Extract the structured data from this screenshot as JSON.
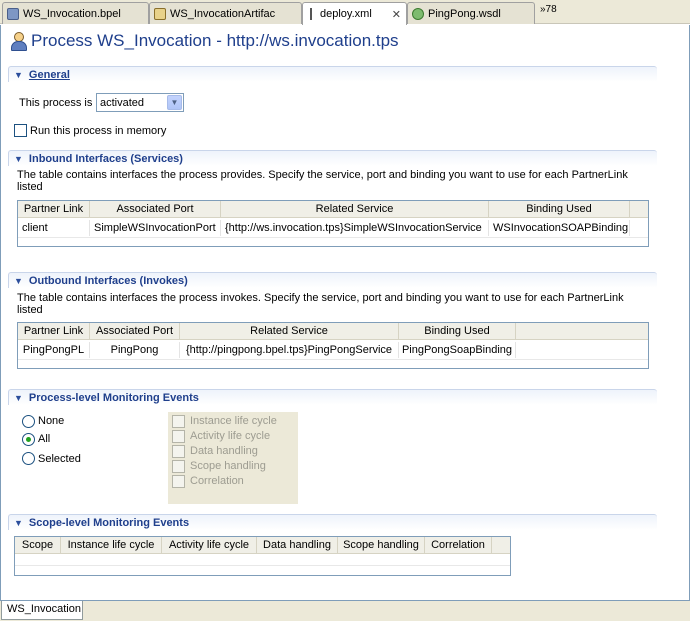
{
  "tabs": [
    {
      "label": "WS_Invocation.bpel",
      "active": false,
      "closable": false,
      "icon": "bpel-file-icon"
    },
    {
      "label": "WS_InvocationArtifac",
      "active": false,
      "closable": false,
      "icon": "artifacts-file-icon"
    },
    {
      "label": "deploy.xml",
      "active": true,
      "closable": true,
      "icon": "deploy-file-icon"
    },
    {
      "label": "PingPong.wsdl",
      "active": false,
      "closable": false,
      "icon": "wsdl-file-icon"
    }
  ],
  "tab_overflow": "»78",
  "page_title": "Process WS_Invocation - http://ws.invocation.tps",
  "general": {
    "section_label": "General",
    "process_is_label": "This process is",
    "process_state": "activated",
    "run_in_memory_label": "Run this process in memory",
    "run_in_memory_checked": false
  },
  "inbound": {
    "section_label": "Inbound Interfaces (Services)",
    "description": "The table contains interfaces the process provides.  Specify the service, port and binding you want to use for each PartnerLink listed",
    "columns": [
      "Partner Link",
      "Associated Port",
      "Related Service",
      "Binding Used"
    ],
    "rows": [
      [
        "client",
        "SimpleWSInvocationPort",
        "{http://ws.invocation.tps}SimpleWSInvocationService",
        "WSInvocationSOAPBinding"
      ]
    ]
  },
  "outbound": {
    "section_label": "Outbound Interfaces (Invokes)",
    "description": "The table contains interfaces the process invokes.  Specify the service, port and binding you want to use for each PartnerLink listed",
    "columns": [
      "Partner Link",
      "Associated Port",
      "Related Service",
      "Binding Used"
    ],
    "rows": [
      [
        "PingPongPL",
        "PingPong",
        "{http://pingpong.bpel.tps}PingPongService",
        "PingPongSoapBinding"
      ]
    ]
  },
  "process_events": {
    "section_label": "Process-level Monitoring Events",
    "radios": [
      {
        "label": "None",
        "selected": false
      },
      {
        "label": "All",
        "selected": true
      },
      {
        "label": "Selected",
        "selected": false
      }
    ],
    "events": [
      "Instance life cycle",
      "Activity life cycle",
      "Data handling",
      "Scope handling",
      "Correlation"
    ]
  },
  "scope_events": {
    "section_label": "Scope-level Monitoring Events",
    "columns": [
      "Scope",
      "Instance life cycle",
      "Activity life cycle",
      "Data handling",
      "Scope handling",
      "Correlation"
    ]
  },
  "bottom_tab": "WS_Invocation"
}
